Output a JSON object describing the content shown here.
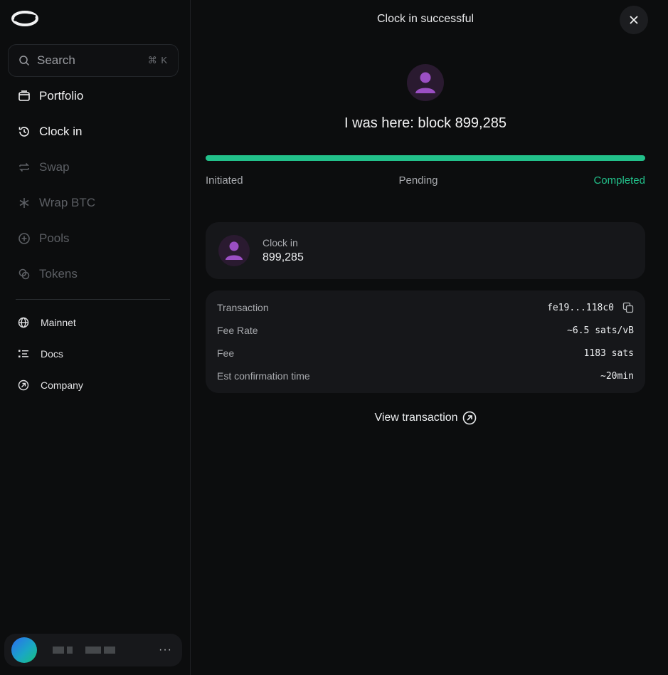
{
  "search": {
    "label": "Search",
    "shortcut": "⌘ K"
  },
  "nav": [
    {
      "label": "Portfolio",
      "icon": "wallet-icon",
      "state": "active"
    },
    {
      "label": "Clock in",
      "icon": "history-icon",
      "state": "active"
    },
    {
      "label": "Swap",
      "icon": "swap-icon",
      "state": "dim"
    },
    {
      "label": "Wrap BTC",
      "icon": "snowflake-icon",
      "state": "dim"
    },
    {
      "label": "Pools",
      "icon": "plus-circle-icon",
      "state": "dim"
    },
    {
      "label": "Tokens",
      "icon": "coins-icon",
      "state": "dim"
    }
  ],
  "sub_nav": [
    {
      "label": "Mainnet",
      "icon": "globe-icon"
    },
    {
      "label": "Docs",
      "icon": "list-icon"
    },
    {
      "label": "Company",
      "icon": "arrow-up-right-circle-icon"
    }
  ],
  "account": {
    "more": "···"
  },
  "modal": {
    "title": "Clock in successful",
    "headline": "I was here: block 899,285",
    "progress": 1.0,
    "steps": [
      "Initiated",
      "Pending",
      "Completed"
    ],
    "card": {
      "label": "Clock in",
      "value": "899,285"
    },
    "details": [
      {
        "key": "Transaction",
        "value": "fe19...118c0"
      },
      {
        "key": "Fee Rate",
        "value": "~6.5 sats/vB"
      },
      {
        "key": "Fee",
        "value": "1183 sats"
      },
      {
        "key": "Est confirmation time",
        "value": "~20min"
      }
    ],
    "view_link": "View transaction"
  },
  "colors": {
    "accent": "#22c08a",
    "avatar_purple": "#9b4fc4",
    "background": "#0c0d0e",
    "card": "#16171a"
  }
}
